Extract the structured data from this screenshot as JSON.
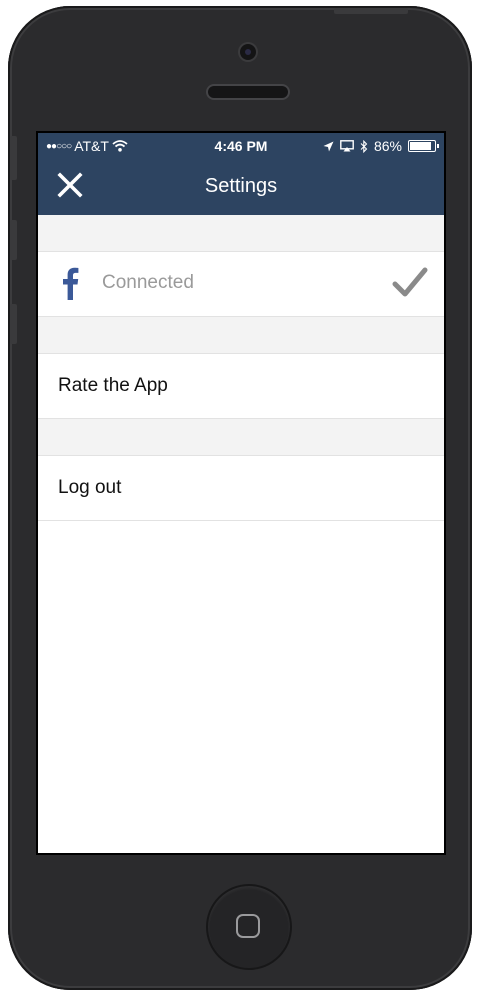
{
  "status_bar": {
    "signal": "●●○○○",
    "carrier": "AT&T",
    "time": "4:46 PM",
    "battery_text": "86%",
    "icons": [
      "wifi-icon",
      "location-icon",
      "airplay-icon",
      "bluetooth-icon",
      "battery-icon"
    ]
  },
  "navbar": {
    "title": "Settings",
    "close_icon": "close-icon",
    "color": "#2d4461"
  },
  "facebook": {
    "icon": "facebook-icon",
    "status": "Connected",
    "check_icon": "checkmark-icon",
    "brand_color": "#3b5998"
  },
  "rows": [
    {
      "label": "Rate the App"
    },
    {
      "label": "Log out"
    }
  ]
}
